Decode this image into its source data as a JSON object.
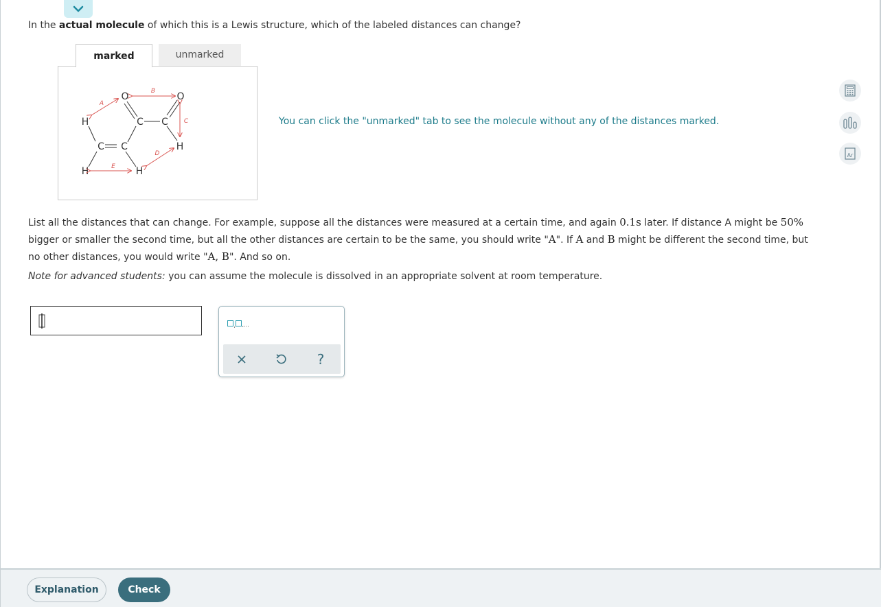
{
  "question": {
    "prefix": "In the ",
    "bold": "actual molecule",
    "suffix": " of which this is a Lewis structure, which of the labeled distances can change?"
  },
  "tabs": [
    {
      "label": "marked",
      "active": true
    },
    {
      "label": "unmarked",
      "active": false
    }
  ],
  "molecule": {
    "atoms": {
      "o1": "O",
      "o2": "O",
      "c1": "C",
      "c2": "C",
      "c3": "C",
      "c4": "C",
      "h1": "H",
      "h2": "H",
      "h3": "H",
      "h4": "H"
    },
    "distance_labels": {
      "a": "A",
      "b": "B",
      "c": "C",
      "d": "D",
      "e": "E"
    }
  },
  "hint": "You can click the \"unmarked\" tab to see the molecule without any of the distances marked.",
  "instructions": {
    "t1": "List all the distances that can change. For example, suppose all the distances were measured at a certain time, and again ",
    "m1": "0.1s",
    "t2": " later. If distance A might be ",
    "m2": "50%",
    "t3": " bigger or smaller the second time, but all the other distances are certain to be the same, you should write \"",
    "m3": "A",
    "t4": "\". If ",
    "m4": "A",
    "t5": " and ",
    "m5": "B",
    "t6": " might be different the second time, but no other distances, you would write \"",
    "m6": "A, B",
    "t7": "\". And so on."
  },
  "note": {
    "italic": "Note for advanced students:",
    "text": " you can assume the molecule is dissolved in an appropriate solvent at room temperature."
  },
  "answer": {
    "value": ""
  },
  "palette": {
    "sequence_label": "□,□,...",
    "icons": [
      "clear-icon",
      "undo-icon",
      "help-icon"
    ],
    "help_glyph": "?"
  },
  "side_tools": [
    "calculator-icon",
    "data-icon",
    "periodic-table-icon"
  ],
  "periodic_symbol": "Ar",
  "footer": {
    "explanation_label": "Explanation",
    "check_label": "Check"
  },
  "colors": {
    "accent": "#3a6e7d",
    "hint": "#1c7b8a",
    "arrow": "#d9534f"
  }
}
